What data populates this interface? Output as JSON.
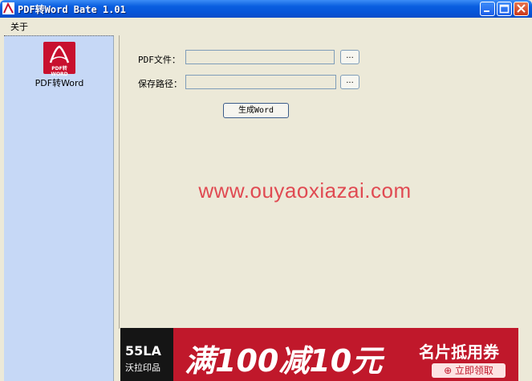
{
  "window": {
    "title": "PDF转Word Bate 1.01"
  },
  "menu": {
    "items": [
      "关于"
    ]
  },
  "sidebar": {
    "logo_text": "PDF转WORD",
    "label": "PDF转Word"
  },
  "form": {
    "pdf_label": "PDF文件：",
    "save_label": "保存路径：",
    "pdf_value": "",
    "save_value": "",
    "browse_label": "...",
    "generate_label": "生成Word"
  },
  "watermark": "www.ouyaoxiazai.com",
  "banner": {
    "brand": "55LA",
    "sub": "沃拉印品",
    "main": "满100减10元",
    "right": "名片抵用券",
    "button": "⊕ 立即领取"
  },
  "colors": {
    "titlebar": "#0654d8",
    "sidebar": "#c6d8f6",
    "banner": "#c0182b",
    "watermark": "#e04a52"
  }
}
